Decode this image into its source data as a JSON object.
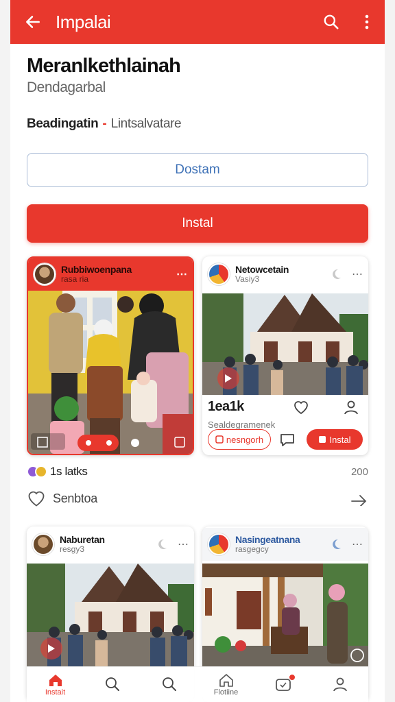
{
  "app": {
    "title": "Impalai",
    "accent_color": "#e8382d"
  },
  "header": {
    "title": "Meranlkethlainah",
    "subtitle": "Dendagarbal",
    "meta_primary": "Beadingatin",
    "meta_separator": "-",
    "meta_secondary": "Lintsalvatare"
  },
  "actions": {
    "outline_label": "Dostam",
    "primary_label": "Instal"
  },
  "posts": [
    {
      "name": "Rubbiwoenpana",
      "handle": "rasa ria",
      "more": "⋯"
    },
    {
      "name": "Netowcetain",
      "handle": "Vasiy3",
      "more": "⋯",
      "stat_value": "1ea1k",
      "stat_sub": "Sealdegramenek",
      "pill_left": "nesngorh",
      "pill_right": "Instal"
    },
    {
      "name": "Naburetan",
      "handle": "resgy3",
      "more": "⋯"
    },
    {
      "name": "Nasingeatnana",
      "handle": "rasgegcy",
      "more": "⋯"
    }
  ],
  "feed_footer": {
    "likes_label": "1s latks",
    "likes_count": "200",
    "comment_placeholder": "Senbtoa"
  },
  "bottom_nav": [
    {
      "label": "Instait",
      "icon": "home-icon",
      "active": true
    },
    {
      "label": "",
      "icon": "search-icon",
      "active": false
    },
    {
      "label": "",
      "icon": "search-icon",
      "active": false
    },
    {
      "label": "Flotiine",
      "icon": "home-outline-icon",
      "active": false
    },
    {
      "label": "",
      "icon": "notification-icon",
      "active": false
    },
    {
      "label": "",
      "icon": "profile-icon",
      "active": false
    }
  ]
}
